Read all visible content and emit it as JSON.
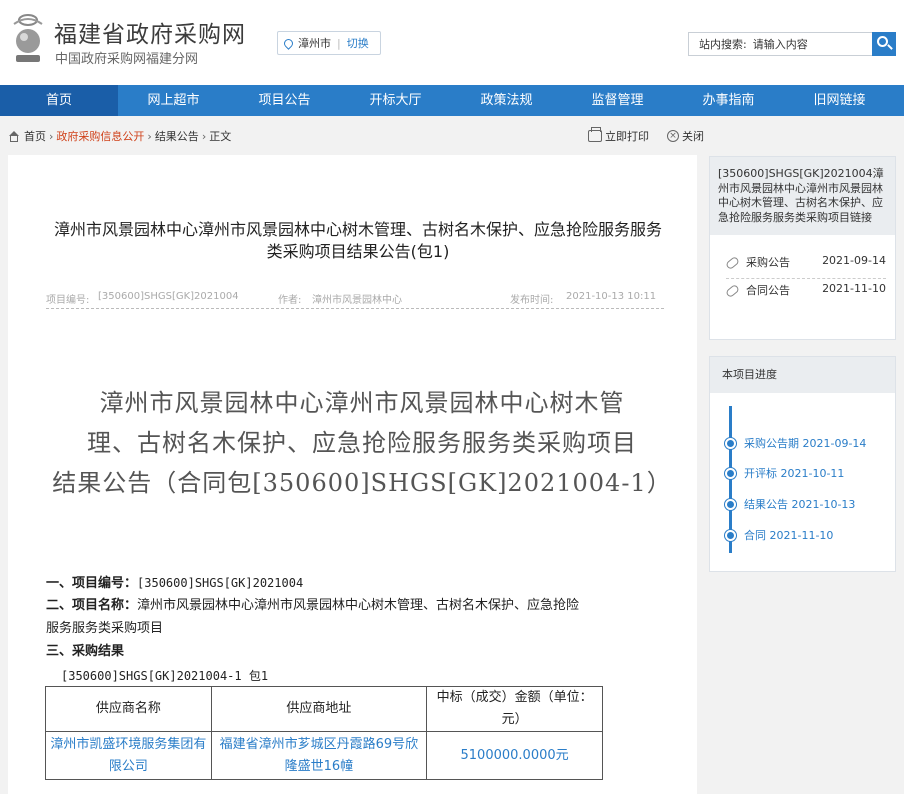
{
  "header": {
    "site_title": "福建省政府采购网",
    "site_subtitle": "中国政府采购网福建分网",
    "city": "漳州市",
    "city_switch": "切换",
    "search_label": "站内搜索:",
    "search_placeholder": "请输入内容"
  },
  "nav": {
    "items": [
      "首页",
      "网上超市",
      "项目公告",
      "开标大厅",
      "政策法规",
      "监督管理",
      "办事指南",
      "旧网链接"
    ]
  },
  "breadcrumb": {
    "items": [
      "首页",
      "政府采购信息公开",
      "结果公告",
      "正文"
    ],
    "print": "立即打印",
    "close": "关闭"
  },
  "article": {
    "title": "漳州市风景园林中心漳州市风景园林中心树木管理、古树名木保护、应急抢险服务服务类采购项目结果公告(包1)",
    "meta": {
      "code_label": "项目编号:",
      "code": "[350600]SHGS[GK]2021004",
      "author_label": "作者:",
      "author": "漳州市风景园林中心",
      "time_label": "发布时间:",
      "time": "2021-10-13 10:11"
    },
    "big_title_lines": [
      "漳州市风景园林中心漳州市风景园林中心树木管",
      "理、古树名木保护、应急抢险服务服务类采购项目",
      "结果公告（合同包[350600]SHGS[GK]2021004-1）"
    ],
    "sec1_label": "一、项目编号：",
    "sec1_value": "[350600]SHGS[GK]2021004",
    "sec2_label": "二、项目名称：",
    "sec2_value_line1": "漳州市风景园林中心漳州市风景园林中心树木管理、古树名木保护、应急抢险",
    "sec2_value_line2": "服务服务类采购项目",
    "sec3_label": "三、采购结果",
    "package": "[350600]SHGS[GK]2021004-1 包1",
    "table": {
      "headers": [
        "供应商名称",
        "供应商地址",
        "中标（成交）金额（单位：元）"
      ],
      "rows": [
        [
          "漳州市凯盛环境服务集团有限公司",
          "福建省漳州市芗城区丹霞路69号欣隆盛世16幢",
          "5100000.0000元"
        ]
      ]
    }
  },
  "side_related": {
    "title": "[350600]SHGS[GK]2021004漳州市风景园林中心漳州市风景园林中心树木管理、古树名木保护、应急抢险服务服务类采购项目链接",
    "links": [
      {
        "label": "采购公告",
        "date": "2021-09-14"
      },
      {
        "label": "合同公告",
        "date": "2021-11-10"
      }
    ]
  },
  "side_progress": {
    "title": "本项目进度",
    "steps": [
      "采购公告期 2021-09-14",
      "开评标 2021-10-11",
      "结果公告 2021-10-13",
      "合同 2021-11-10"
    ]
  },
  "colors": {
    "nav_blue": "#2a7dc8",
    "nav_active": "#1a5ea8",
    "breadcrumb_red": "#d0421b"
  }
}
